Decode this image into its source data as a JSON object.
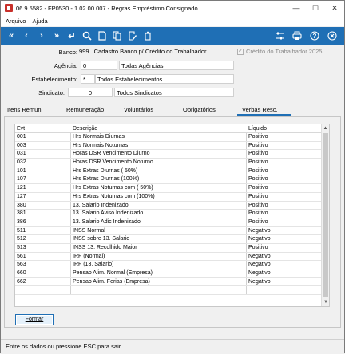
{
  "window": {
    "title": "06.9.5582 - FP0530 - 1.02.00.007 - Regras Empréstimo Consignado",
    "controls": {
      "minimize": "—",
      "maximize": "☐",
      "close": "✕"
    }
  },
  "menu": {
    "items": [
      "Arquivo",
      "Ajuda"
    ]
  },
  "toolbar": {
    "left_icons": [
      "first-record-icon",
      "previous-record-icon",
      "next-record-icon",
      "last-record-icon",
      "return-icon",
      "search-icon",
      "new-document-icon",
      "copy-document-icon",
      "edit-icon",
      "delete-icon"
    ],
    "right_icons": [
      "settings-sliders-icon",
      "print-icon",
      "help-icon",
      "close-circle-icon"
    ]
  },
  "header": {
    "banco_label": "Banco:",
    "banco_code": "999",
    "banco_name": "Cadastro Banco p/ Crédito do Trabalhador",
    "credito_checkbox_label": "Crédito do Trabalhador 2025",
    "agencia_label": "Agência:",
    "agencia_code": "0",
    "agencia_name": "Todas Agências",
    "estab_label": "Estabelecimento:",
    "estab_code": "*",
    "estab_name": "Todos Estabelecimentos",
    "sindicato_label": "Sindicato:",
    "sindicato_code": "0",
    "sindicato_name": "Todos Sindicatos"
  },
  "tabs": [
    "Itens Remun",
    "Remuneração",
    "Voluntários",
    "Obrigatórios",
    "Verbas Resc."
  ],
  "table": {
    "columns": [
      "Evt",
      "Descrição",
      "Líquido"
    ],
    "rows": [
      [
        "001",
        "Hrs Normais Diurnas",
        "Positivo"
      ],
      [
        "003",
        "Hrs Normais Noturnas",
        "Positivo"
      ],
      [
        "031",
        "Horas DSR Vencimento Diurno",
        "Positivo"
      ],
      [
        "032",
        "Horas DSR Vencimento Noturno",
        "Positivo"
      ],
      [
        "101",
        "Hrs Extras Diurnas ( 50%)",
        "Positivo"
      ],
      [
        "107",
        "Hrs Extras Diurnas (100%)",
        "Positivo"
      ],
      [
        "121",
        "Hrs Extras Noturnas com ( 50%)",
        "Positivo"
      ],
      [
        "127",
        "Hrs Extras Noturnas com (100%)",
        "Positivo"
      ],
      [
        "380",
        "13. Salario Indenizado",
        "Positivo"
      ],
      [
        "381",
        "13. Salario Aviso Indenizado",
        "Positivo"
      ],
      [
        "386",
        "13. Salario Adic Indenizado",
        "Positivo"
      ],
      [
        "511",
        "INSS Normal",
        "Negativo"
      ],
      [
        "512",
        "INSS sobre 13. Salario",
        "Negativo"
      ],
      [
        "513",
        "INSS 13. Recolhido Maior",
        "Positivo"
      ],
      [
        "561",
        "IRF (Normal)",
        "Negativo"
      ],
      [
        "563",
        "IRF (13. Salario)",
        "Negativo"
      ],
      [
        "660",
        "Pensao Alim. Normal (Empresa)",
        "Negativo"
      ],
      [
        "662",
        "Pensao Alim. Ferias (Empresa)",
        "Negativo"
      ],
      [
        "",
        "",
        ""
      ]
    ]
  },
  "button": {
    "formar_label": "Formar"
  },
  "status": {
    "text": "Entre os dados ou pressione ESC para sair."
  }
}
